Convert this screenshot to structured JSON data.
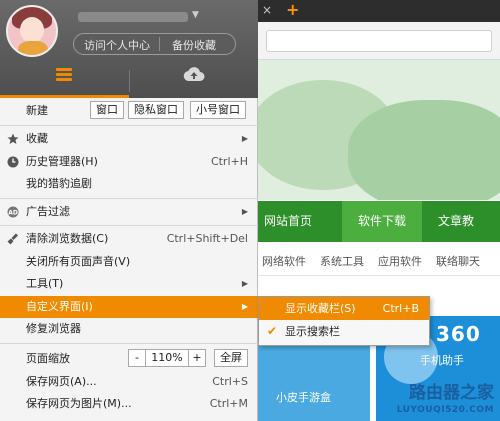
{
  "browser": {
    "tab_close_glyph": "×",
    "tab_add_glyph": "+"
  },
  "page": {
    "nav": [
      "网站首页",
      "软件下载",
      "文章教"
    ],
    "subnav": [
      "网络软件",
      "系统工具",
      "应用软件",
      "联络聊天"
    ],
    "card_label": "小皮手游盒",
    "promo_text": "360",
    "promo_sub": "手机助手",
    "watermark": {
      "line1": "路由器之家",
      "line2": "LUYOUQI520.COM"
    }
  },
  "panel": {
    "caret": "▼",
    "pill_buttons": [
      "访问个人中心",
      "备份收藏"
    ],
    "accent": "#f08a00"
  },
  "menu": {
    "new_label": "新建",
    "new_buttons": [
      "窗口",
      "隐私窗口",
      "小号窗口"
    ],
    "items": [
      {
        "label": "收藏",
        "arrow": "▶"
      },
      {
        "label": "历史管理器(H)",
        "shortcut": "Ctrl+H"
      },
      {
        "label": "我的猎豹追剧"
      },
      {
        "label": "广告过滤",
        "arrow": "▶"
      },
      {
        "label": "清除浏览数据(C)",
        "shortcut": "Ctrl+Shift+Del"
      },
      {
        "label": "关闭所有页面声音(V)"
      },
      {
        "label": "工具(T)",
        "arrow": "▶"
      },
      {
        "label": "自定义界面(I)",
        "arrow": "▶"
      },
      {
        "label": "修复浏览器"
      },
      {
        "label": "保存网页(A)...",
        "shortcut": "Ctrl+S"
      },
      {
        "label": "保存网页为图片(M)...",
        "shortcut": "Ctrl+M"
      }
    ],
    "zoom": {
      "label": "页面缩放",
      "minus": "-",
      "value": "110%",
      "plus": "+",
      "fullscreen": "全屏"
    }
  },
  "submenu": {
    "items": [
      {
        "label": "显示收藏栏(S)",
        "shortcut": "Ctrl+B"
      },
      {
        "label": "显示搜索栏",
        "check": "✔"
      }
    ]
  }
}
